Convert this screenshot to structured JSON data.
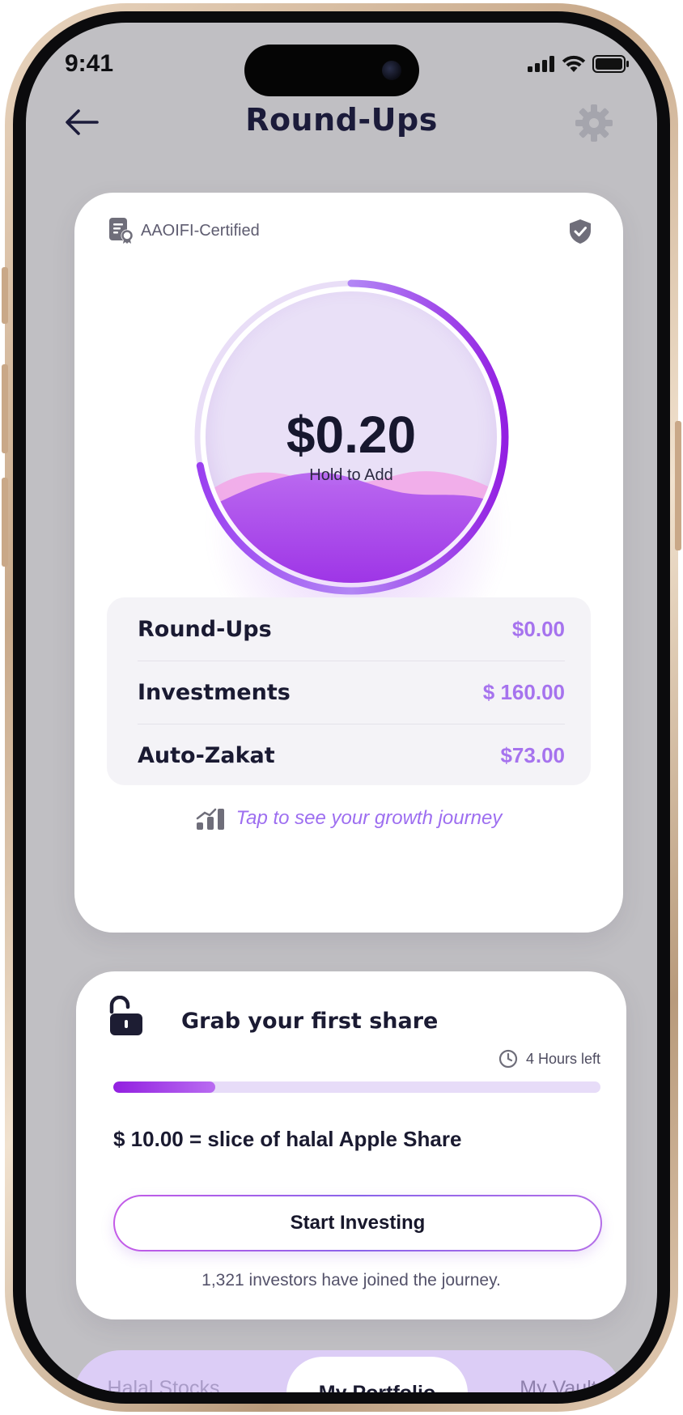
{
  "status_bar": {
    "time": "9:41"
  },
  "header": {
    "title": "Round-Ups"
  },
  "main_card": {
    "certification": "AAOIFI-Certified",
    "dial": {
      "value": "$0.20",
      "hint": "Hold to Add",
      "progress": 0.72
    },
    "summary": [
      {
        "label": "Round-Ups",
        "value": "$0.00"
      },
      {
        "label": "Investments",
        "value": "$ 160.00"
      },
      {
        "label": "Auto-Zakat",
        "value": "$73.00"
      }
    ],
    "growth_link": "Tap to see your growth journey"
  },
  "share_card": {
    "title": "Grab your first share",
    "time_left": "4 Hours left",
    "progress": 0.21,
    "description": "$ 10.00 = slice of halal Apple Share",
    "button_label": "Start Investing",
    "joined_text": "1,321 investors have joined the journey."
  },
  "tabs": [
    {
      "label": "Halal Stocks",
      "active": false
    },
    {
      "label": "My Portfolio",
      "active": true
    },
    {
      "label": "My Vault",
      "active": false
    }
  ],
  "colors": {
    "accent": "#a673ee",
    "progress": "#9220e0",
    "title": "#1b1b3a",
    "screen_bg": "#c0bfc3"
  }
}
